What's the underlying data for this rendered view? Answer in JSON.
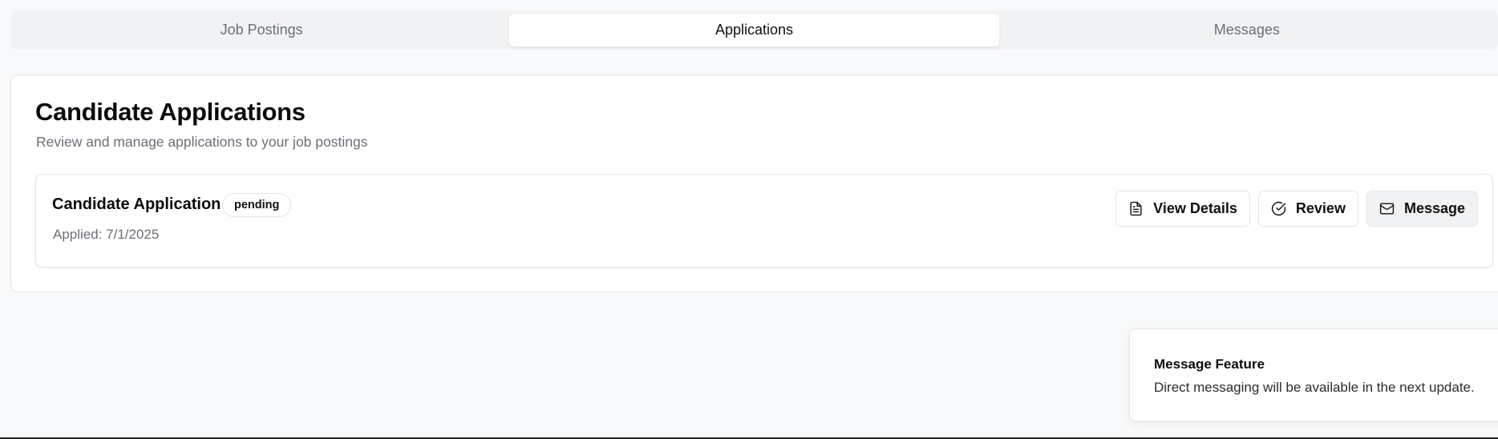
{
  "tabs": [
    {
      "label": "Job Postings",
      "active": false
    },
    {
      "label": "Applications",
      "active": true
    },
    {
      "label": "Messages",
      "active": false
    }
  ],
  "main": {
    "title": "Candidate Applications",
    "subtitle": "Review and manage applications to your job postings"
  },
  "application": {
    "title": "Candidate Application",
    "status": "pending",
    "applied": "Applied: 7/1/2025",
    "actions": {
      "view_details": {
        "label": "View Details",
        "icon": "file-text-icon"
      },
      "review": {
        "label": "Review",
        "icon": "check-circle-icon"
      },
      "message": {
        "label": "Message",
        "icon": "mail-icon"
      }
    }
  },
  "toast": {
    "title": "Message Feature",
    "body": "Direct messaging will be available in the next update."
  }
}
